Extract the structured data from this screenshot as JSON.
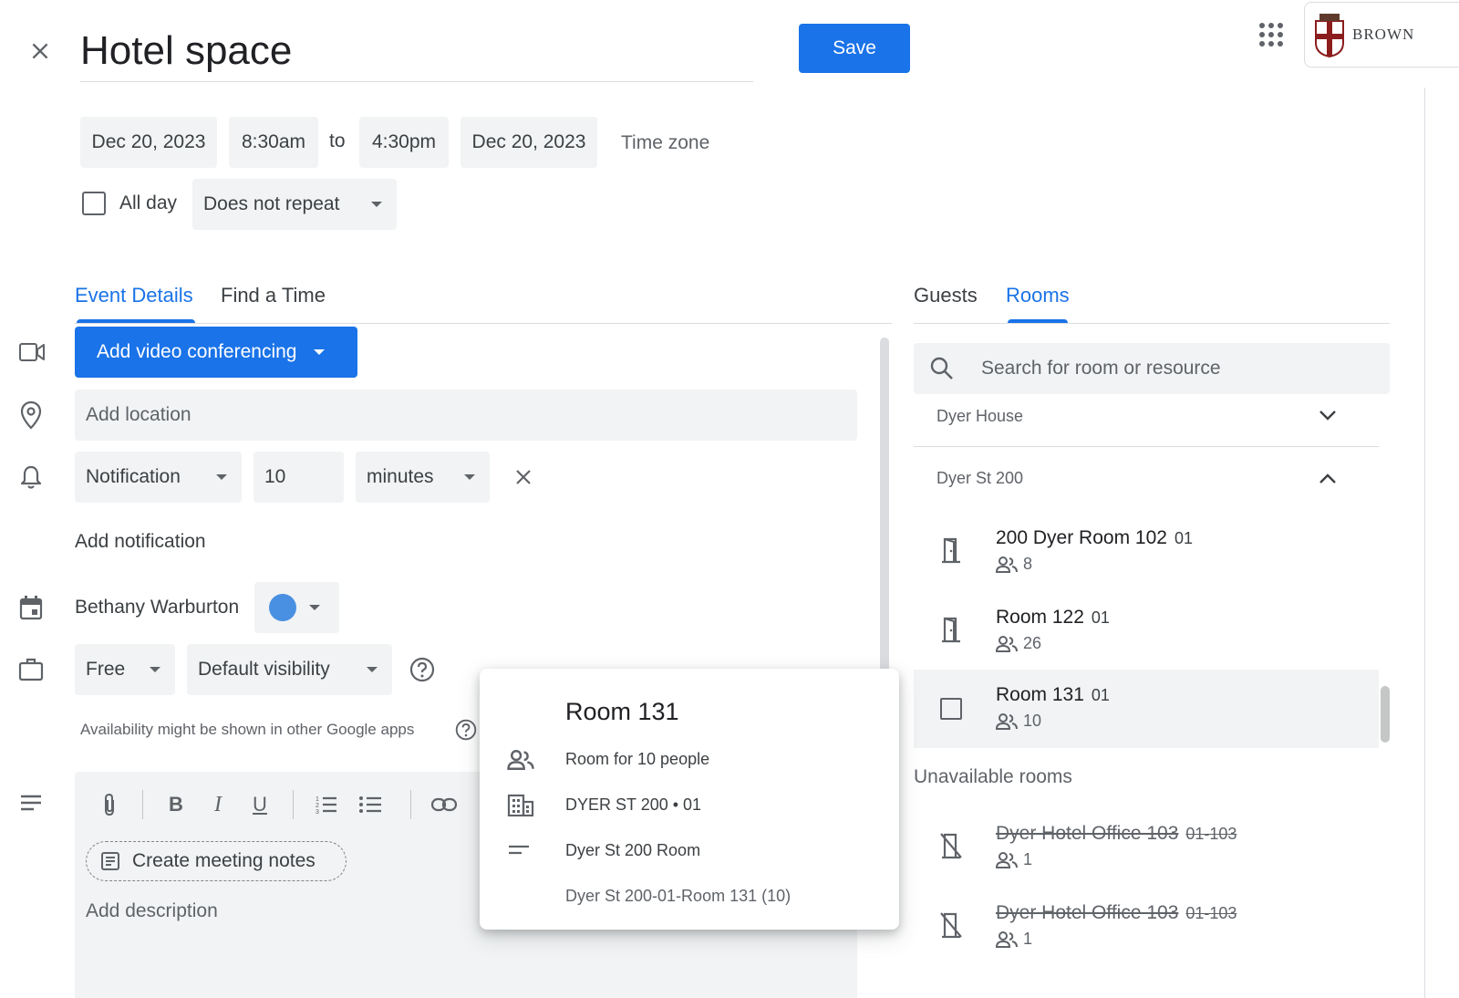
{
  "header": {
    "title": "Hotel space",
    "save_label": "Save",
    "org_logo_text": "BROWN"
  },
  "datetime": {
    "start_date": "Dec 20, 2023",
    "start_time": "8:30am",
    "to_label": "to",
    "end_time": "4:30pm",
    "end_date": "Dec 20, 2023",
    "time_zone_label": "Time zone",
    "all_day_label": "All day",
    "repeat_value": "Does not repeat"
  },
  "tabs_left": [
    {
      "label": "Event Details",
      "active": true
    },
    {
      "label": "Find a Time",
      "active": false
    }
  ],
  "details": {
    "video_button_label": "Add video conferencing",
    "location_placeholder": "Add location",
    "notification_type": "Notification",
    "notification_amount": "10",
    "notification_unit": "minutes",
    "add_notification_label": "Add notification",
    "calendar_owner": "Bethany Warburton",
    "calendar_color": "#4285f4",
    "busy_status": "Free",
    "visibility": "Default visibility",
    "availability_note": "Availability might be shown in other Google apps",
    "meeting_notes_label": "Create meeting notes",
    "description_placeholder": "Add description"
  },
  "tabs_right": [
    {
      "label": "Guests",
      "active": false
    },
    {
      "label": "Rooms",
      "active": true
    }
  ],
  "rooms": {
    "search_placeholder": "Search for room or resource",
    "groups": [
      {
        "label": "Dyer House",
        "expanded": false
      },
      {
        "label": "Dyer St 200",
        "expanded": true
      }
    ],
    "available": [
      {
        "name": "200 Dyer Room 102",
        "floor": "01",
        "capacity": "8"
      },
      {
        "name": "Room 122",
        "floor": "01",
        "capacity": "26"
      },
      {
        "name": "Room 131",
        "floor": "01",
        "capacity": "10"
      }
    ],
    "unavailable_label": "Unavailable rooms",
    "unavailable": [
      {
        "name": "Dyer Hotel Office 103",
        "floor": "01-103",
        "capacity": "1"
      },
      {
        "name": "Dyer Hotel Office 103",
        "floor": "01-103",
        "capacity": "1"
      }
    ]
  },
  "room_popup": {
    "title": "Room 131",
    "capacity_text": "Room for 10 people",
    "building_text": "DYER ST 200 • 01",
    "description_text": "Dyer St 200 Room",
    "full_name": "Dyer St 200-01-Room 131 (10)"
  },
  "colors": {
    "accent": "#1a73e8",
    "save_button": "#1a73e8",
    "field_bg": "#f1f3f4"
  }
}
